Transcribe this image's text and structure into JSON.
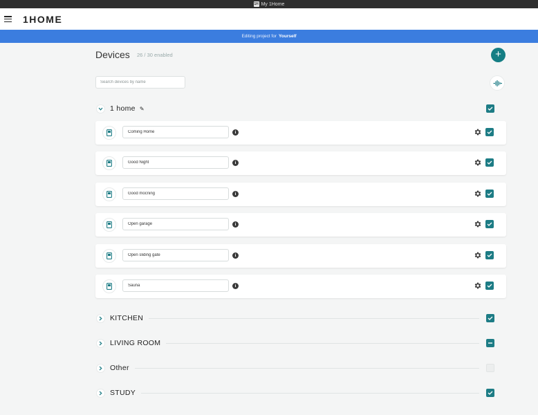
{
  "window": {
    "title": "My 1Home",
    "badge": "1H"
  },
  "header": {
    "logo": "1HOME"
  },
  "banner": {
    "prefix": "Editing project for",
    "target": "Yourself"
  },
  "page": {
    "title": "Devices",
    "enabled_count": "26 / 30 enabled"
  },
  "search": {
    "placeholder": "Search devices by name",
    "value": ""
  },
  "colors": {
    "accent": "#1d7c85",
    "banner": "#3b7ddf"
  },
  "groups": {
    "home": {
      "name": "1 home",
      "expanded": true,
      "state": "checked"
    },
    "kitchen": {
      "name": "KITCHEN",
      "expanded": false,
      "state": "checked"
    },
    "living_room": {
      "name": "LIVING ROOM",
      "expanded": false,
      "state": "partial"
    },
    "other": {
      "name": "Other",
      "expanded": false,
      "state": "unchecked"
    },
    "study": {
      "name": "STUDY",
      "expanded": false,
      "state": "checked"
    }
  },
  "devices": [
    {
      "name": "Coming Home",
      "icon": "scene-icon",
      "enabled": true
    },
    {
      "name": "Good Night",
      "icon": "scene-icon",
      "enabled": true
    },
    {
      "name": "Good mocning",
      "icon": "scene-icon",
      "enabled": true
    },
    {
      "name": "Open garage",
      "icon": "scene-icon",
      "enabled": true
    },
    {
      "name": "Open sliding gate",
      "icon": "scene-icon",
      "enabled": true
    },
    {
      "name": "Sauna",
      "icon": "scene-icon",
      "enabled": true
    }
  ]
}
